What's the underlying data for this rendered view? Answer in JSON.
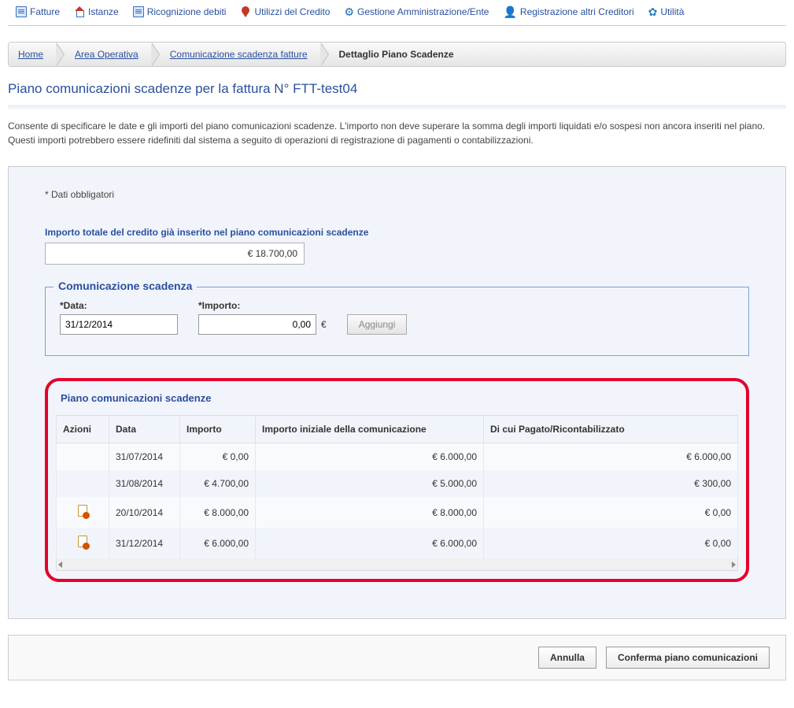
{
  "menu": {
    "fatture": "Fatture",
    "istanze": "Istanze",
    "ricognizione": "Ricognizione debiti",
    "utilizzi": "Utilizzi del Credito",
    "gestione": "Gestione Amministrazione/Ente",
    "registrazione": "Registrazione altri Creditori",
    "utilita": "Utilità"
  },
  "breadcrumb": {
    "home": "Home",
    "area": "Area Operativa",
    "comm": "Comunicazione scadenza fatture",
    "detail": "Dettaglio Piano Scadenze"
  },
  "page_title": "Piano comunicazioni scadenze per la fattura N° FTT-test04",
  "description": "Consente di specificare le date e gli importi del piano comunicazioni scadenze. L'importo non deve superare la somma degli importi liquidati e/o sospesi non ancora inseriti nel piano. Questi importi potrebbero essere ridefiniti dal sistema a seguito di operazioni di registrazione di pagamenti o contabilizzazioni.",
  "mandatory": "* Dati obbligatori",
  "total_label": "Importo totale del credito già inserito nel piano comunicazioni scadenze",
  "total_value": "€ 18.700,00",
  "fs": {
    "legend": "Comunicazione scadenza",
    "data_label": "*Data:",
    "data_value": "31/12/2014",
    "importo_label": "*Importo:",
    "importo_value": "0,00",
    "euro": "€",
    "btn_add": "Aggiungi"
  },
  "table": {
    "title": "Piano comunicazioni scadenze",
    "headers": {
      "azioni": "Azioni",
      "data": "Data",
      "importo": "Importo",
      "init": "Importo iniziale della comunicazione",
      "pagato": "Di cui Pagato/Ricontabilizzato"
    },
    "rows": [
      {
        "has_delete": false,
        "data": "31/07/2014",
        "importo": "€   0,00",
        "init": "€   6.000,00",
        "pagato": "€   6.000,00"
      },
      {
        "has_delete": false,
        "data": "31/08/2014",
        "importo": "€   4.700,00",
        "init": "€   5.000,00",
        "pagato": "€   300,00"
      },
      {
        "has_delete": true,
        "data": "20/10/2014",
        "importo": "€   8.000,00",
        "init": "€   8.000,00",
        "pagato": "€   0,00"
      },
      {
        "has_delete": true,
        "data": "31/12/2014",
        "importo": "€   6.000,00",
        "init": "€   6.000,00",
        "pagato": "€   0,00"
      }
    ]
  },
  "buttons": {
    "cancel": "Annulla",
    "confirm": "Conferma piano comunicazioni"
  }
}
